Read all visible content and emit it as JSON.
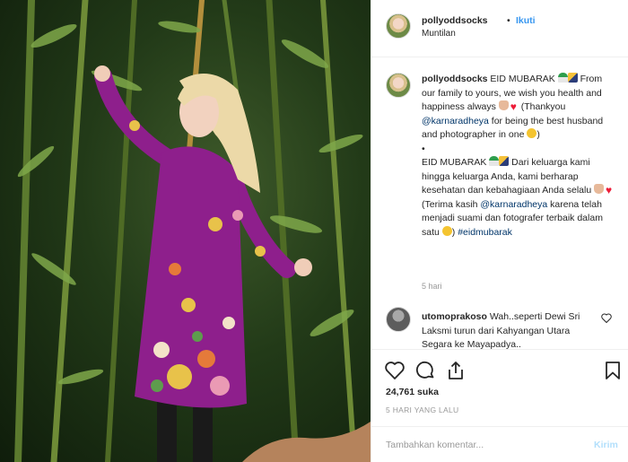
{
  "photo": {
    "alt": "post-photo"
  },
  "header": {
    "username": "pollyoddsocks",
    "dot": "•",
    "follow": "Ikuti",
    "location": "Muntilan"
  },
  "caption": {
    "username": "pollyoddsocks",
    "p1": " EID MUBARAK ",
    "p2": " From our family to yours, we wish you health and happiness always ",
    "p3": " (Thankyou ",
    "mention1": "@karnaradheya",
    "p4": " for being the best husband and photographer in one ",
    "p5": ")",
    "bullet": "•",
    "p6": "EID MUBARAK ",
    "p7": " Dari keluarga kami hingga keluarga Anda, kami berharap kesehatan dan kebahagiaan Anda selalu ",
    "p8": " (Terima kasih ",
    "mention2": "@karnaradheya",
    "p9": " karena telah menjadi suami dan fotografer terbaik dalam satu ",
    "p10": ") ",
    "hashtag": "#eidmubarak",
    "time": "5 hari"
  },
  "reply": {
    "username": "utomoprakoso",
    "text": " Wah..seperti Dewi Sri Laksmi turun dari Kahyangan Utara Segara ke Mayapadya.."
  },
  "actions": {
    "likes": "24,761 suka",
    "ago": "5 HARI YANG LALU"
  },
  "add_comment": {
    "placeholder": "Tambahkan komentar...",
    "send": "Kirim"
  },
  "colors": {
    "link": "#3897f0",
    "mention": "#003569",
    "send_disabled": "#b2dffc",
    "dress": "#8e1f8c"
  },
  "icons": [
    "heart-icon",
    "comment-icon",
    "share-icon",
    "bookmark-icon"
  ]
}
